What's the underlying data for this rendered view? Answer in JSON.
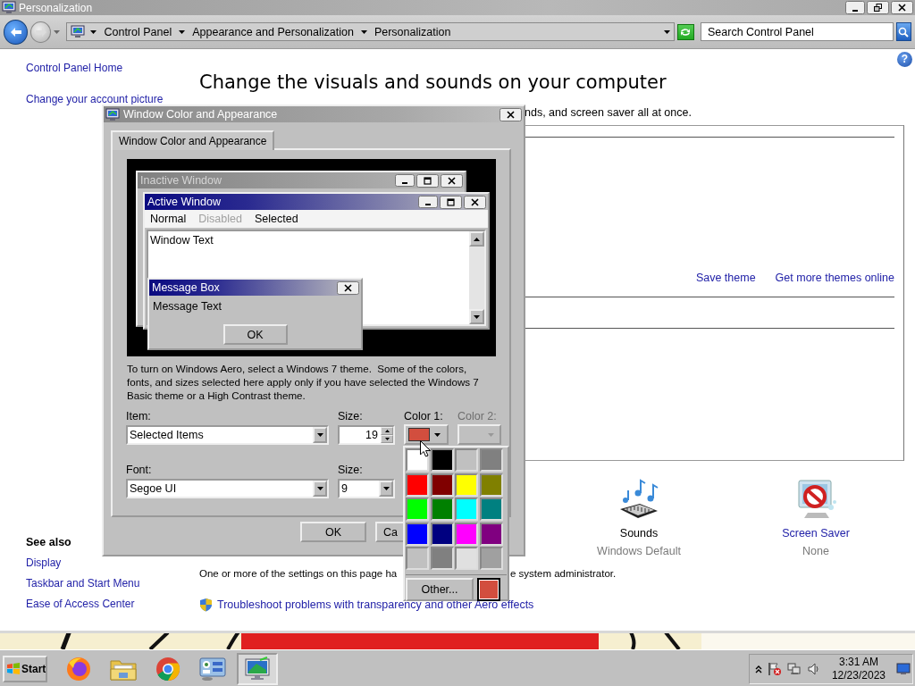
{
  "window": {
    "title": "Personalization"
  },
  "address_bar": {
    "breadcrumbs": [
      "Control Panel",
      "Appearance and Personalization",
      "Personalization"
    ],
    "search": {
      "placeholder": "Search Control Panel"
    }
  },
  "help_button": "?",
  "sidebar": {
    "links": [
      "Control Panel Home",
      "Change your account picture"
    ],
    "see_also": {
      "heading": "See also",
      "links": [
        "Display",
        "Taskbar and Start Menu",
        "Ease of Access Center"
      ]
    }
  },
  "main": {
    "heading": "Change the visuals and sounds on your computer",
    "intro": "nds, and screen saver all at once.",
    "theme_links": [
      "Save theme",
      "Get more themes online"
    ],
    "settings": [
      {
        "kind": "sounds",
        "label": "Sounds",
        "value": "Windows Default",
        "link": false
      },
      {
        "kind": "screensaver",
        "label": "Screen Saver",
        "value": "None",
        "link": true
      }
    ],
    "notice": [
      "One or more of the settings on this page ha",
      "e system administrator."
    ],
    "troubleshoot_link": "Troubleshoot problems with transparency and other Aero effects"
  },
  "dialog": {
    "title": "Window Color and Appearance",
    "tabs": [
      {
        "label": "Window Color and Appearance",
        "selected": true
      }
    ],
    "preview": {
      "inactive_title": "Inactive Window",
      "active_title": "Active Window",
      "menu": [
        {
          "label": "Normal",
          "kind": "normal"
        },
        {
          "label": "Disabled",
          "kind": "disabled"
        },
        {
          "label": "Selected",
          "kind": "selected"
        }
      ],
      "window_text": "Window Text",
      "message_title": "Message Box",
      "message_text": "Message Text",
      "ok": "OK"
    },
    "description": "To turn on Windows Aero, select a Windows 7 theme.  Some of the colors, fonts, and sizes selected here apply only if you have selected the Windows 7 Basic theme or a High Contrast theme.",
    "item": {
      "label": "Item:",
      "value": "Selected Items"
    },
    "item_size": {
      "label": "Size:",
      "value": "19"
    },
    "color1": {
      "label": "Color 1:",
      "color": "#d24e3e"
    },
    "color2": {
      "label": "Color 2:",
      "disabled": true
    },
    "font": {
      "label": "Font:",
      "value": "Segoe UI"
    },
    "font_size": {
      "label": "Size:",
      "value": "9"
    },
    "buttons": [
      "OK",
      "Ca"
    ]
  },
  "color_menu": {
    "swatches": [
      {
        "color": "#ffffff"
      },
      {
        "color": "#000000"
      },
      {
        "color": "#c0c0c0"
      },
      {
        "color": "#808080"
      },
      {
        "color": "#ff0000"
      },
      {
        "color": "#800000"
      },
      {
        "color": "#ffff00"
      },
      {
        "color": "#808000"
      },
      {
        "color": "#00ff00"
      },
      {
        "color": "#008000"
      },
      {
        "color": "#00ffff"
      },
      {
        "color": "#008080"
      },
      {
        "color": "#0000ff"
      },
      {
        "color": "#000080"
      },
      {
        "color": "#ff00ff"
      },
      {
        "color": "#800080"
      },
      {
        "color": "#c0c0c0"
      },
      {
        "color": "#808080"
      },
      {
        "color": "#e0e0e0"
      },
      {
        "color": "#a0a0a0"
      }
    ],
    "other": "Other...",
    "current_color": {
      "color": "#d24e3e"
    }
  },
  "taskbar": {
    "start": "Start",
    "apps": [
      {
        "kind": "firefox",
        "selected": false
      },
      {
        "kind": "folder",
        "selected": false
      },
      {
        "kind": "chrome",
        "selected": false
      },
      {
        "kind": "control_panel",
        "selected": false
      },
      {
        "kind": "personalization",
        "selected": true
      }
    ],
    "clock": {
      "time": "3:31 AM",
      "date": "12/23/2023"
    }
  }
}
